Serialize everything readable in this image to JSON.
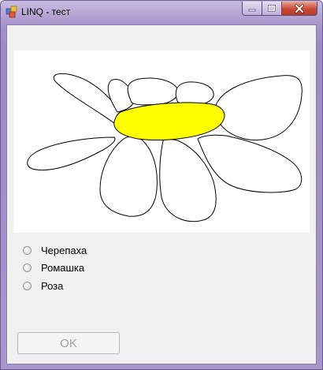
{
  "window": {
    "title": "LINQ - тест",
    "icon": "app-window-icon"
  },
  "title_controls": {
    "minimize_icon": "minimize-icon",
    "maximize_icon": "maximize-icon",
    "close_icon": "close-icon"
  },
  "picture": {
    "subject": "flower-drawing",
    "petal_color": "#ffffff",
    "center_color": "#ffff00",
    "outline_color": "#000000"
  },
  "options": [
    {
      "label": "Черепаха",
      "selected": false
    },
    {
      "label": "Ромашка",
      "selected": false
    },
    {
      "label": "Роза",
      "selected": false
    }
  ],
  "ok_button": {
    "label": "OK",
    "enabled": false
  },
  "colors": {
    "frame": "#a894cc",
    "close_button": "#c94a34",
    "client_background": "#f0f0f0",
    "disabled_text": "#a0a0a0"
  }
}
